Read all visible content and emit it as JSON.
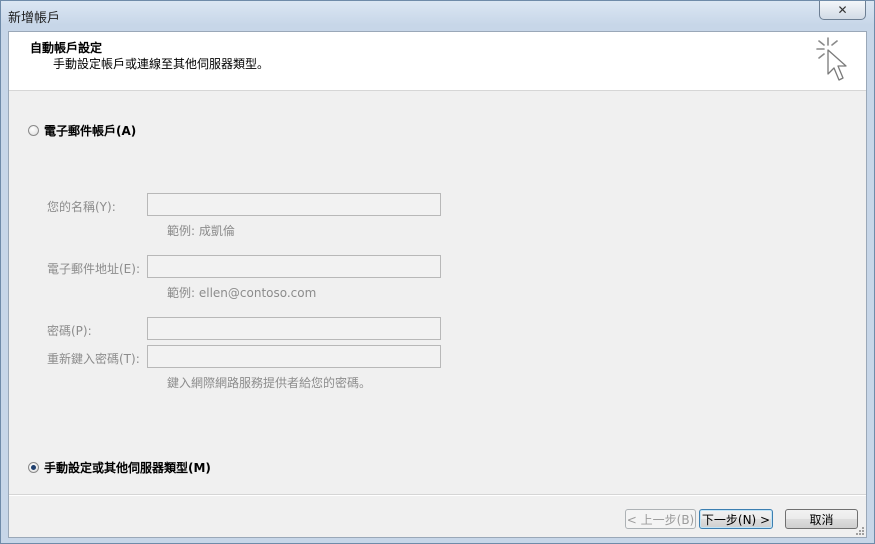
{
  "window": {
    "title": "新增帳戶"
  },
  "header": {
    "title": "自動帳戶設定",
    "subtitle": "手動設定帳戶或連線至其他伺服器類型。"
  },
  "options": {
    "email_account": {
      "label": "電子郵件帳戶(A)",
      "selected": false
    },
    "manual_setup": {
      "label": "手動設定或其他伺服器類型(M)",
      "selected": true
    }
  },
  "form": {
    "name": {
      "label": "您的名稱(Y):",
      "value": "",
      "hint": "範例: 成凱倫"
    },
    "email": {
      "label": "電子郵件地址(E):",
      "value": "",
      "hint": "範例: ellen@contoso.com"
    },
    "password": {
      "label": "密碼(P):",
      "value": ""
    },
    "retype_password": {
      "label": "重新鍵入密碼(T):",
      "value": "",
      "hint": "鍵入網際網路服務提供者給您的密碼。"
    }
  },
  "buttons": {
    "back": "< 上一步(B)",
    "next": "下一步(N) >",
    "cancel": "取消"
  },
  "icons": {
    "close": "close-icon",
    "wizard": "sparkle-cursor-icon"
  }
}
